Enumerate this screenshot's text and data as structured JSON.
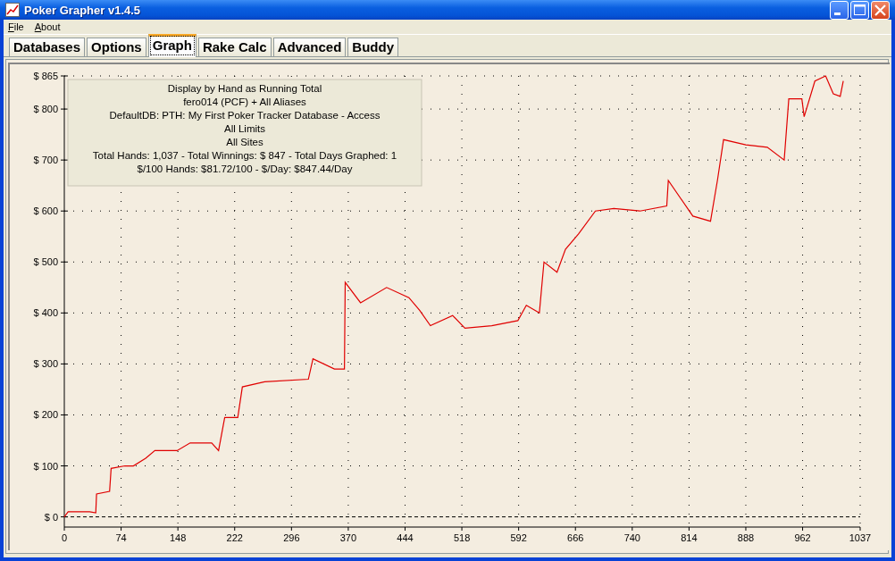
{
  "window": {
    "title": "Poker Grapher v1.4.5"
  },
  "menu": [
    "File",
    "About"
  ],
  "tabs": [
    {
      "label": "Databases",
      "selected": false
    },
    {
      "label": "Options",
      "selected": false
    },
    {
      "label": "Graph",
      "selected": true
    },
    {
      "label": "Rake Calc",
      "selected": false
    },
    {
      "label": "Advanced",
      "selected": false
    },
    {
      "label": "Buddy",
      "selected": false
    }
  ],
  "graph": {
    "info": [
      "Display by Hand as Running Total",
      "fero014 (PCF) + All Aliases",
      "DefaultDB: PTH: My First Poker Tracker Database - Access",
      "All Limits",
      "All Sites",
      "Total Hands: 1,037 - Total Winnings: $ 847 - Total Days Graphed: 1",
      "$/100 Hands: $81.72/100 - $/Day: $847.44/Day"
    ],
    "chart_data": {
      "type": "line",
      "grid": true,
      "xlim": [
        0,
        1037
      ],
      "ylim": [
        -20,
        865
      ],
      "xticks": [
        0,
        74,
        148,
        222,
        296,
        370,
        444,
        518,
        592,
        666,
        740,
        814,
        888,
        962,
        1037
      ],
      "yticks": [
        {
          "value": 0,
          "label": "$ 0"
        },
        {
          "value": 100,
          "label": "$ 100"
        },
        {
          "value": 200,
          "label": "$ 200"
        },
        {
          "value": 300,
          "label": "$ 300"
        },
        {
          "value": 400,
          "label": "$ 400"
        },
        {
          "value": 500,
          "label": "$ 500"
        },
        {
          "value": 600,
          "label": "$ 600"
        },
        {
          "value": 700,
          "label": "$ 700"
        },
        {
          "value": 800,
          "label": "$ 800"
        },
        {
          "value": 865,
          "label": "$ 865"
        }
      ],
      "x": [
        0,
        5,
        33,
        41,
        42,
        59,
        61,
        79,
        90,
        106,
        118,
        147,
        164,
        192,
        201,
        209,
        226,
        232,
        261,
        318,
        324,
        352,
        365,
        366,
        386,
        420,
        449,
        463,
        477,
        506,
        522,
        557,
        591,
        602,
        619,
        625,
        642,
        653,
        670,
        692,
        716,
        750,
        785,
        787,
        819,
        842,
        851,
        859,
        888,
        916,
        938,
        944,
        961,
        964,
        978,
        992,
        1002,
        1011,
        1015
      ],
      "series": [
        {
          "color": "#e00000",
          "values": [
            0,
            10,
            10,
            8,
            45,
            50,
            95,
            100,
            100,
            115,
            130,
            130,
            145,
            145,
            130,
            195,
            195,
            255,
            265,
            270,
            310,
            290,
            290,
            460,
            420,
            450,
            430,
            405,
            375,
            395,
            370,
            375,
            385,
            415,
            400,
            500,
            480,
            525,
            555,
            600,
            605,
            600,
            610,
            660,
            590,
            580,
            660,
            740,
            730,
            725,
            700,
            820,
            820,
            785,
            855,
            865,
            830,
            825,
            855
          ]
        }
      ]
    }
  }
}
